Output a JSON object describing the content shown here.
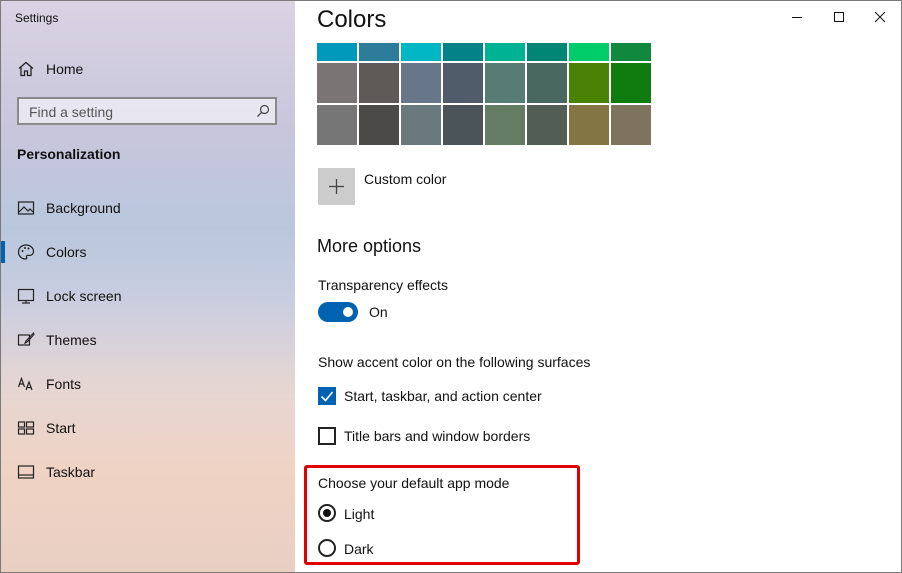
{
  "window": {
    "app_title": "Settings"
  },
  "sidebar": {
    "home_label": "Home",
    "search_placeholder": "Find a setting",
    "section_title": "Personalization",
    "items": [
      {
        "label": "Background",
        "icon": "picture-icon",
        "selected": false
      },
      {
        "label": "Colors",
        "icon": "palette-icon",
        "selected": true
      },
      {
        "label": "Lock screen",
        "icon": "lock-screen-icon",
        "selected": false
      },
      {
        "label": "Themes",
        "icon": "brush-icon",
        "selected": false
      },
      {
        "label": "Fonts",
        "icon": "font-icon",
        "selected": false
      },
      {
        "label": "Start",
        "icon": "start-grid-icon",
        "selected": false
      },
      {
        "label": "Taskbar",
        "icon": "taskbar-icon",
        "selected": false
      }
    ]
  },
  "content": {
    "page_title": "Colors",
    "swatch_rows": [
      [
        "#0099bc",
        "#2d7d9a",
        "#00b7c3",
        "#038387",
        "#00b294",
        "#018574",
        "#00cc6a",
        "#10893e"
      ],
      [
        "#7a7574",
        "#5d5a58",
        "#68768a",
        "#515c6b",
        "#567c73",
        "#486860",
        "#498205",
        "#107c10"
      ],
      [
        "#767676",
        "#4c4a48",
        "#69797e",
        "#4a5459",
        "#647c64",
        "#525e54",
        "#847545",
        "#7e735f"
      ]
    ],
    "custom_color_label": "Custom color",
    "more_options_heading": "More options",
    "transparency_label": "Transparency effects",
    "transparency_state": "On",
    "accent_surfaces_label": "Show accent color on the following surfaces",
    "checkbox_start_label": "Start, taskbar, and action center",
    "checkbox_titlebars_label": "Title bars and window borders",
    "app_mode_label": "Choose your default app mode",
    "radio_light_label": "Light",
    "radio_dark_label": "Dark"
  },
  "colors": {
    "accent": "#0063b1",
    "highlight": "#e00000"
  }
}
